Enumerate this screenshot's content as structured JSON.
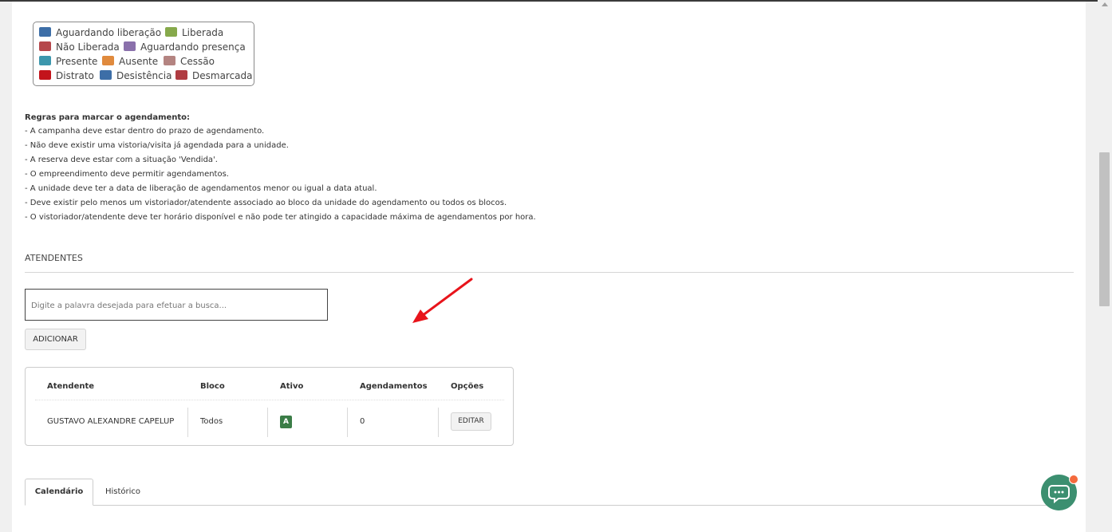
{
  "legend": [
    {
      "label": "Aguardando liberação",
      "color": "#3d6ea7"
    },
    {
      "label": "Liberada",
      "color": "#86a94b"
    },
    {
      "label": "Não Liberada",
      "color": "#b5474b"
    },
    {
      "label": "Aguardando presença",
      "color": "#8a70ab"
    },
    {
      "label": "Presente",
      "color": "#3c97ad"
    },
    {
      "label": "Ausente",
      "color": "#e08a3d"
    },
    {
      "label": "Cessão",
      "color": "#b48481"
    },
    {
      "label": "Distrato",
      "color": "#c3141b"
    },
    {
      "label": "Desistência",
      "color": "#3d6ea7"
    },
    {
      "label": "Desmarcada",
      "color": "#b03c42"
    }
  ],
  "rules": {
    "title": "Regras para marcar o agendamento:",
    "items": [
      "- A campanha deve estar dentro do prazo de agendamento.",
      "- Não deve existir uma vistoria/visita já agendada para a unidade.",
      "- A reserva deve estar com a situação 'Vendida'.",
      "- O empreendimento deve permitir agendamentos.",
      "- A unidade deve ter a data de liberação de agendamentos menor ou igual a data atual.",
      "- Deve existir pelo menos um vistoriador/atendente associado ao bloco da unidade do agendamento ou todos os blocos.",
      "- O vistoriador/atendente deve ter horário disponível e não pode ter atingido a capacidade máxima de agendamentos por hora."
    ]
  },
  "atendentes": {
    "title": "ATENDENTES",
    "search_placeholder": "Digite a palavra desejada para efetuar a busca...",
    "add_label": "ADICIONAR",
    "columns": [
      "Atendente",
      "Bloco",
      "Ativo",
      "Agendamentos",
      "Opções"
    ],
    "rows": [
      {
        "atendente": "GUSTAVO ALEXANDRE CAPELUP",
        "bloco": "Todos",
        "ativo": "A",
        "agendamentos": "0",
        "opcao": "EDITAR"
      }
    ]
  },
  "tabs": [
    "Calendário",
    "Histórico"
  ],
  "colors": {
    "active_badge": "#3b7d47",
    "chat_button": "#3c8f70",
    "notification_dot": "#f46a3d",
    "annotation_arrow": "#e8141b"
  },
  "icons": {
    "chat": "chat-bubble-icon",
    "annotation": "red-arrow-annotation"
  }
}
